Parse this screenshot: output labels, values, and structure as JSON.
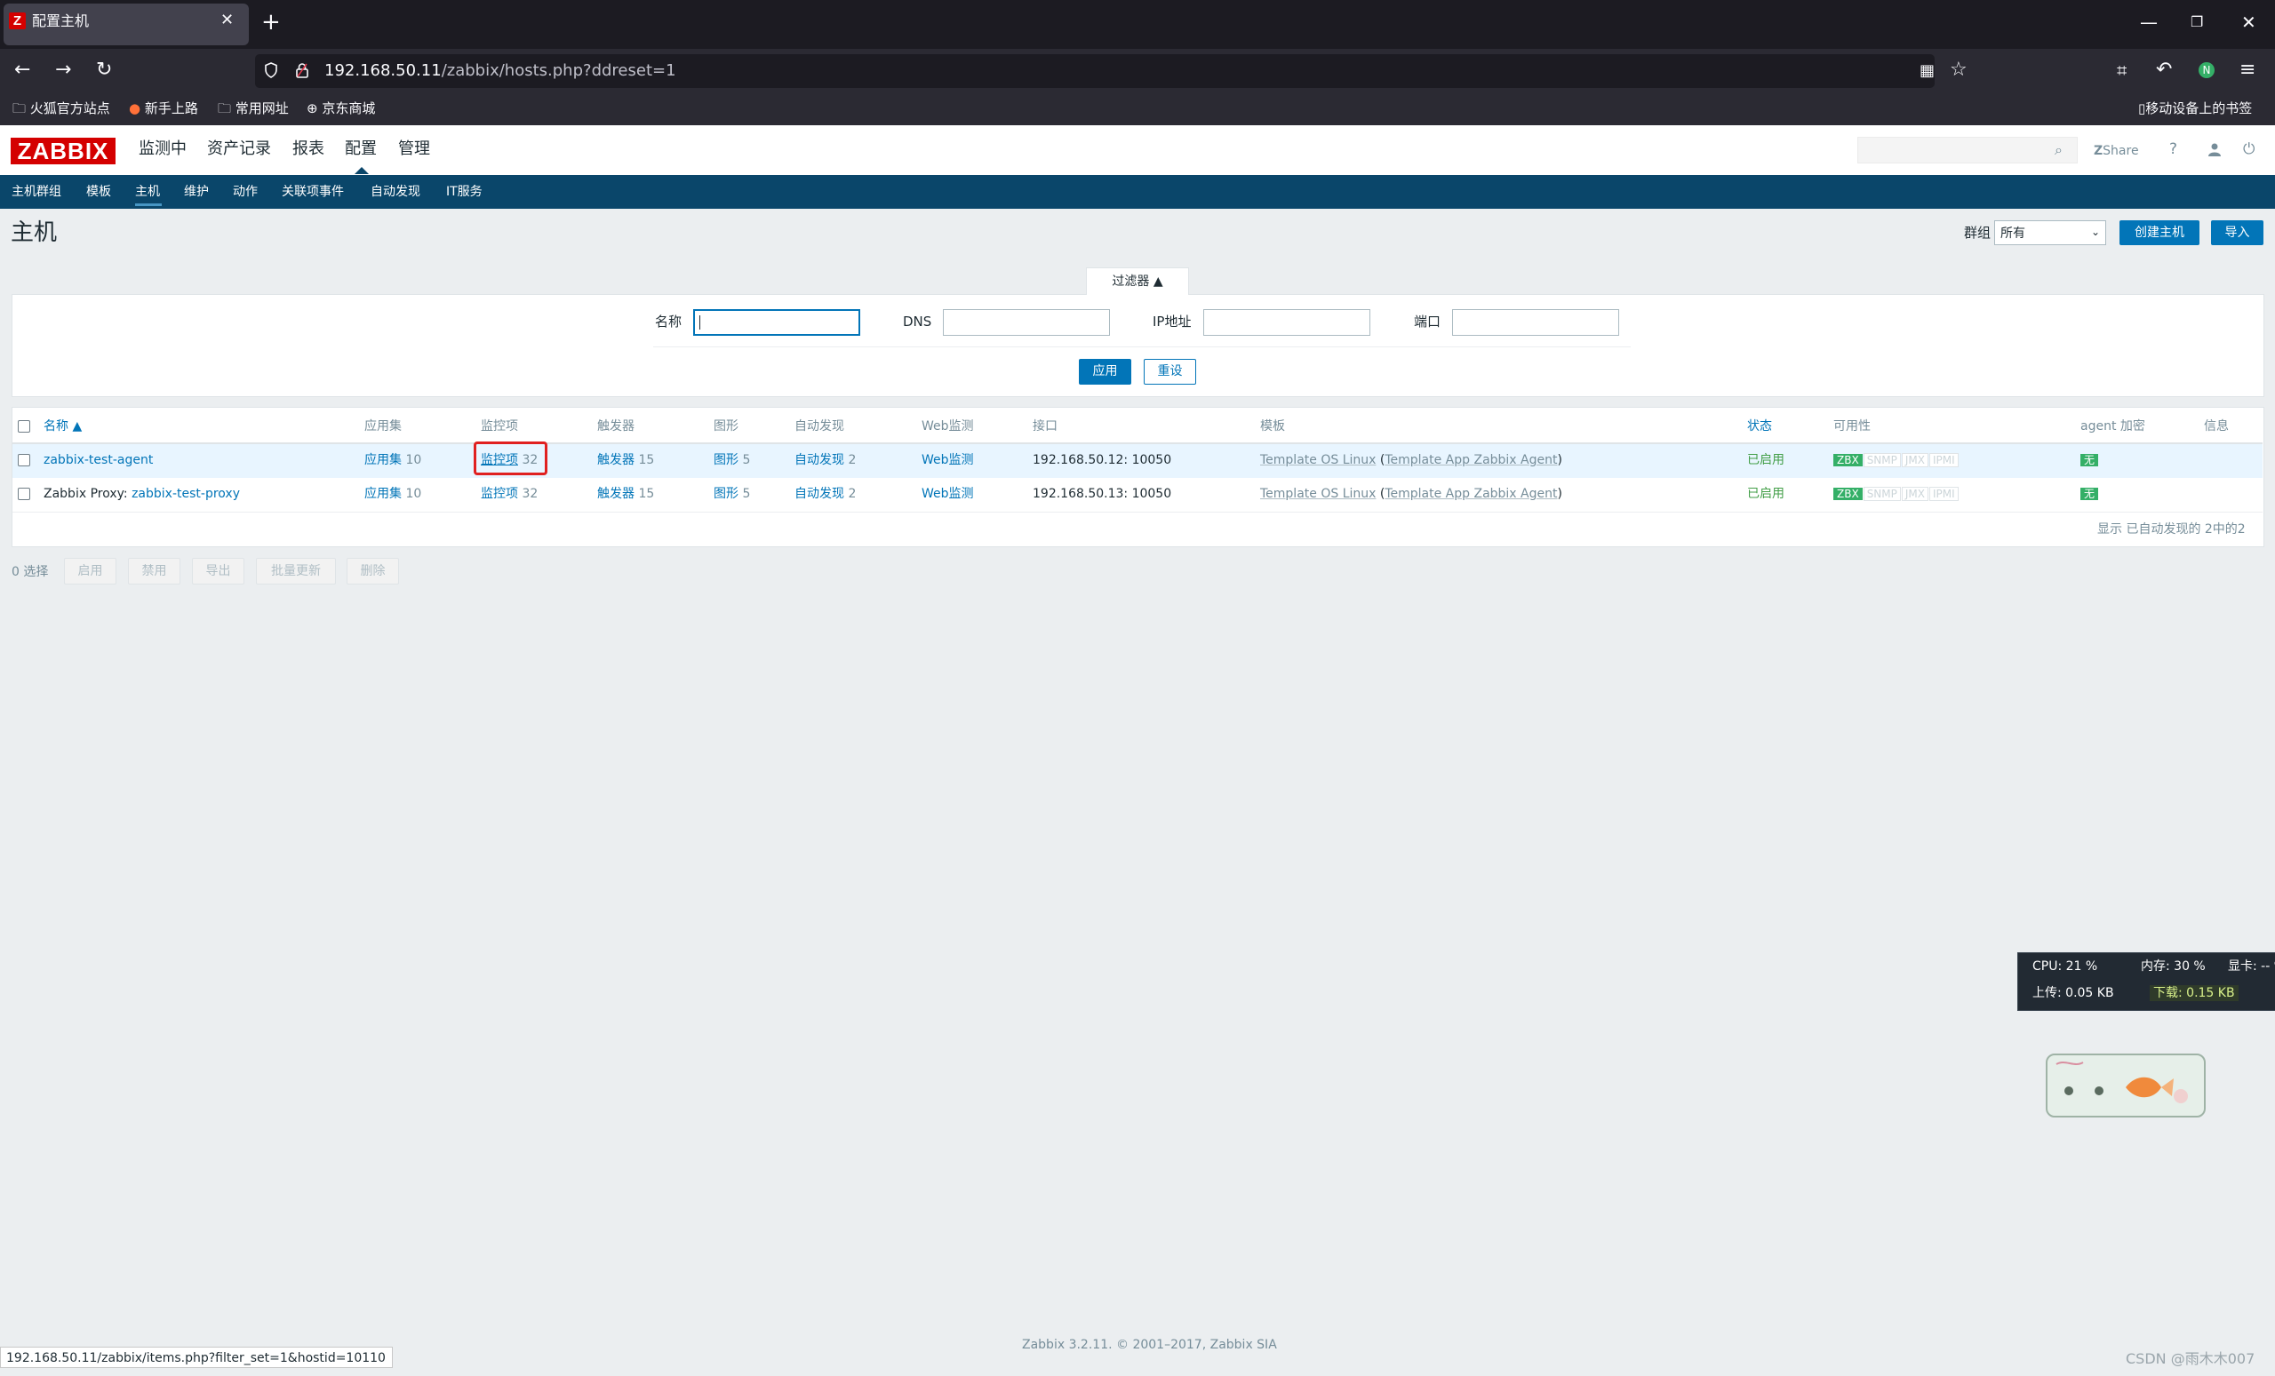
{
  "browser": {
    "tab_title": "配置主机",
    "tab_favicon": "Z",
    "url_host": "192.168.50.11",
    "url_path": "/zabbix/hosts.php?ddreset=1",
    "bookmarks": [
      "火狐官方站点",
      "新手上路",
      "常用网址",
      "京东商城"
    ],
    "mobile_bookmarks": "移动设备上的书签",
    "icons": [
      "back-arrow-icon",
      "forward-arrow-icon",
      "reload-icon",
      "shield-icon",
      "lock-icon",
      "qr-code-icon",
      "star-icon"
    ]
  },
  "header": {
    "logo": "ZABBIX",
    "menu": [
      "监测中",
      "资产记录",
      "报表",
      "配置",
      "管理"
    ],
    "active_menu": "配置",
    "share": "Share",
    "help": "?"
  },
  "submenu": [
    "主机群组",
    "模板",
    "主机",
    "维护",
    "动作",
    "关联项事件",
    "自动发现",
    "IT服务"
  ],
  "page": {
    "title": "主机",
    "group_label": "群组",
    "group_value": "所有",
    "create_host": "创建主机",
    "import": "导入"
  },
  "filter": {
    "tab": "过滤器 ▲",
    "name_label": "名称",
    "dns_label": "DNS",
    "ip_label": "IP地址",
    "port_label": "端口",
    "apply": "应用",
    "reset": "重设"
  },
  "table": {
    "headers": [
      "名称 ▲",
      "应用集",
      "监控项",
      "触发器",
      "图形",
      "自动发现",
      "Web监测",
      "接口",
      "模板",
      "状态",
      "可用性",
      "agent 加密",
      "信息"
    ],
    "rows": [
      {
        "name_prefix": "",
        "name": "zabbix-test-agent",
        "apps": "应用集",
        "apps_count": "10",
        "items": "监控项",
        "items_count": "32",
        "triggers": "触发器",
        "triggers_count": "15",
        "graphs": "图形",
        "graphs_count": "5",
        "discovery": "自动发现",
        "discovery_count": "2",
        "web": "Web监测",
        "interface": "192.168.50.12: 10050",
        "template": "Template OS Linux",
        "template_sub": "Template App Zabbix Agent",
        "status": "已启用",
        "avail": [
          "ZBX",
          "SNMP",
          "JMX",
          "IPMI"
        ],
        "encryption": "无"
      },
      {
        "name_prefix": "Zabbix Proxy:",
        "name": "zabbix-test-proxy",
        "apps": "应用集",
        "apps_count": "10",
        "items": "监控项",
        "items_count": "32",
        "triggers": "触发器",
        "triggers_count": "15",
        "graphs": "图形",
        "graphs_count": "5",
        "discovery": "自动发现",
        "discovery_count": "2",
        "web": "Web监测",
        "interface": "192.168.50.13: 10050",
        "template": "Template OS Linux",
        "template_sub": "Template App Zabbix Agent",
        "status": "已启用",
        "avail": [
          "ZBX",
          "SNMP",
          "JMX",
          "IPMI"
        ],
        "encryption": "无"
      }
    ],
    "display_count": "显示 已自动发现的 2中的2"
  },
  "actions": {
    "selected": "0 选择",
    "buttons": [
      "启用",
      "禁用",
      "导出",
      "批量更新",
      "删除"
    ]
  },
  "sysmon": {
    "cpu": "CPU: 21 %",
    "mem": "内存: 30 %",
    "gpu": "显卡: -- %",
    "upload": "上传: 0.05 KB",
    "download": "下载: 0.15 KB"
  },
  "footer": "Zabbix 3.2.11. © 2001–2017, Zabbix SIA",
  "statusbar": "192.168.50.11/zabbix/items.php?filter_set=1&hostid=10110",
  "watermark": "CSDN @雨木木007",
  "colors": {
    "brand": "#d40000",
    "nav_dark": "#0a466a",
    "link": "#0275b8",
    "enabled_green": "#429e47",
    "zbx_green": "#34af67",
    "highlight_red": "#e02020"
  }
}
